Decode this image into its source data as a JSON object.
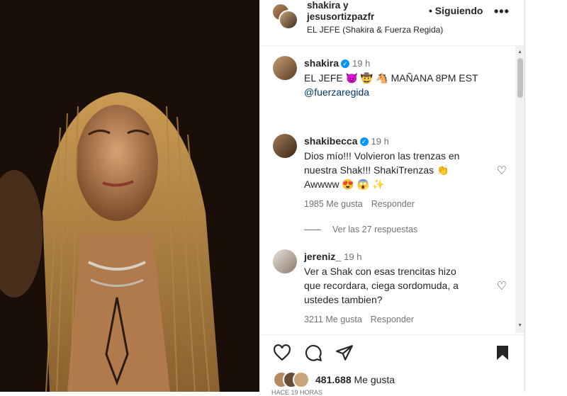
{
  "header": {
    "users_line1": "shakira y",
    "users_line2": "jesusortizpazfr",
    "follow_label": "• Siguiendo",
    "more_label": "•••",
    "subtitle": "EL JEFE (Shakira & Fuerza Regida)"
  },
  "caption": {
    "user": "shakira",
    "time": "19 h",
    "text_line1": "EL JEFE 😈 🤠 🐴 MAÑANA 8PM EST",
    "mention": "@fuerzaregida"
  },
  "comments": [
    {
      "user": "shakibecca",
      "verified": true,
      "time": "19 h",
      "lines": [
        "Dios mío!!! Volvieron las trenzas en",
        "nuestra Shak!!! ShakiTrenzas 👏",
        "Awwww 😍 😱 ✨"
      ],
      "likes": "1985 Me gusta",
      "reply": "Responder"
    },
    {
      "user": "jereniz_",
      "verified": false,
      "time": "19 h",
      "lines": [
        "Ver a Shak con esas trencitas hizo",
        "que recordara, ciega sordomuda, a",
        "ustedes tambien?"
      ],
      "likes": "3211 Me gusta",
      "reply": "Responder"
    }
  ],
  "view_replies": "Ver las 27 respuestas",
  "footer": {
    "likes_count": "481.688",
    "likes_label": "Me gusta",
    "time_ago": "HACE 19 HORAS"
  },
  "icons": {
    "heart": "heart-icon",
    "comment": "comment-icon",
    "share": "share-icon",
    "bookmark": "bookmark-icon"
  },
  "colors": {
    "verified": "#0095f6",
    "mention": "#00376b",
    "muted": "#737373"
  }
}
